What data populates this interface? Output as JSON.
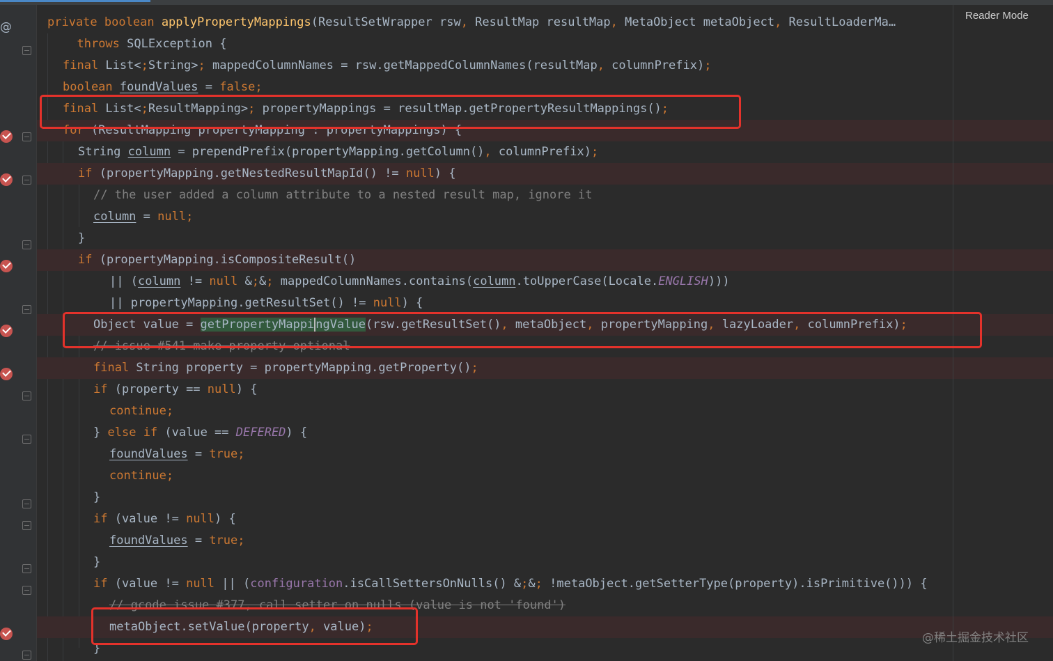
{
  "app": {
    "reader_mode_label": "Reader Mode"
  },
  "gutter": {
    "annotation_glyph": "@"
  },
  "code_lines": [
    {
      "text": "private boolean applyPropertyMappings(ResultSetWrapper rsw, ResultMap resultMap, MetaObject metaObject, ResultLoaderMa…"
    },
    {
      "text": "  throws SQLException {"
    },
    {
      "text": "final List<String> mappedColumnNames = rsw.getMappedColumnNames(resultMap, columnPrefix);"
    },
    {
      "text": "boolean foundValues = false;"
    },
    {
      "text": "final List<ResultMapping> propertyMappings = resultMap.getPropertyResultMappings();"
    },
    {
      "text": "for (ResultMapping propertyMapping : propertyMappings) {"
    },
    {
      "text": "String column = prependPrefix(propertyMapping.getColumn(), columnPrefix);"
    },
    {
      "text": "if (propertyMapping.getNestedResultMapId() != null) {"
    },
    {
      "text": "// the user added a column attribute to a nested result map, ignore it"
    },
    {
      "text": "column = null;"
    },
    {
      "text": "}"
    },
    {
      "text": "if (propertyMapping.isCompositeResult()"
    },
    {
      "text": "|| (column != null && mappedColumnNames.contains(column.toUpperCase(Locale.ENGLISH)))"
    },
    {
      "text": "|| propertyMapping.getResultSet() != null) {"
    },
    {
      "text": "Object value = getPropertyMappingValue(rsw.getResultSet(), metaObject, propertyMapping, lazyLoader, columnPrefix);"
    },
    {
      "text": "// issue #541 make property optional"
    },
    {
      "text": "final String property = propertyMapping.getProperty();"
    },
    {
      "text": "if (property == null) {"
    },
    {
      "text": "continue;"
    },
    {
      "text": "} else if (value == DEFERED) {"
    },
    {
      "text": "foundValues = true;"
    },
    {
      "text": "continue;"
    },
    {
      "text": "}"
    },
    {
      "text": "if (value != null) {"
    },
    {
      "text": "foundValues = true;"
    },
    {
      "text": "}"
    },
    {
      "text": "if (value != null || (configuration.isCallSettersOnNulls() && !metaObject.getSetterType(property).isPrimitive())) {"
    },
    {
      "text": "// gcode issue #377, call setter on nulls (value is not 'found')"
    },
    {
      "text": "metaObject.setValue(property, value);"
    },
    {
      "text": "}"
    }
  ],
  "highlight_boxes": [
    {
      "target": "propertyMappings declaration"
    },
    {
      "target": "getPropertyMappingValue call"
    },
    {
      "target": "metaObject.setValue call"
    }
  ],
  "watermark": "@稀土掘金技术社区",
  "colors": {
    "background": "#2b2b2b",
    "keyword": "#cc7832",
    "method_decl": "#ffc66d",
    "field": "#9876aa",
    "comment": "#808080",
    "breakpoint": "#c75450",
    "highlight_box": "#e4322b"
  }
}
